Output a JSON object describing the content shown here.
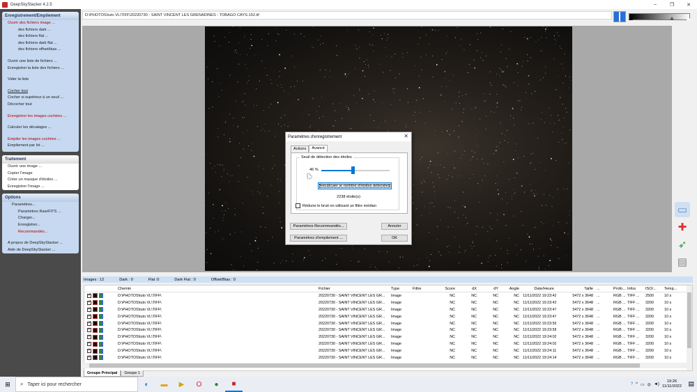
{
  "window": {
    "title": "DeepSkyStacker 4.2.5",
    "controls": [
      "–",
      "❐",
      "✕"
    ]
  },
  "sidebar": {
    "sections": [
      {
        "title": "Enregistrement/Empilement",
        "style": "blue",
        "items": [
          {
            "label": "Ouvrir des fichiers image ...",
            "color": "red",
            "indent": false,
            "underline": false
          },
          {
            "label": "des fichiers dark ...",
            "indent": true
          },
          {
            "label": "des fichiers flat ...",
            "indent": true
          },
          {
            "label": "des fichiers dark flat ...",
            "indent": true
          },
          {
            "label": "des fichiers offset/bias ...",
            "indent": true
          },
          {
            "gap": true
          },
          {
            "label": "Ouvrir une liste de fichiers ..."
          },
          {
            "label": "Enregistrer la liste des fichiers ..."
          },
          {
            "gap": true
          },
          {
            "label": "Vider la liste"
          },
          {
            "gap": true
          },
          {
            "label": "Cocher tout",
            "underline": true
          },
          {
            "label": "Cocher si supérieur à un seuil ..."
          },
          {
            "label": "Décocher tout"
          },
          {
            "gap": true
          },
          {
            "label": "Enregistrer les images cochées ...",
            "color": "red"
          },
          {
            "gap": true
          },
          {
            "label": "Calculer les décalages ..."
          },
          {
            "gap": true
          },
          {
            "label": "Empiler les images cochées ...",
            "color": "red"
          },
          {
            "label": "Empilement par lot ..."
          }
        ]
      },
      {
        "title": "Traitement",
        "style": "white",
        "items": [
          {
            "label": "Ouvrir une image ..."
          },
          {
            "label": "Copier l'image"
          },
          {
            "label": "Créer un masque d'étoiles ..."
          },
          {
            "label": "Enregistrer l'image ..."
          }
        ]
      },
      {
        "title": "Options",
        "style": "blue",
        "items": [
          {
            "label": "Paramètres...",
            "indent_level": 1
          },
          {
            "label": "Paramètres Raw/FITS ...",
            "indent": true
          },
          {
            "label": "Charger...",
            "indent": true
          },
          {
            "label": "Enregistrer...",
            "indent": true
          },
          {
            "label": "Recommandés...",
            "indent": true,
            "color": "red"
          },
          {
            "gap": true
          },
          {
            "label": "A propos de DeepSkyStacker ..."
          },
          {
            "label": "Aide de DeepSkyStacker ..."
          }
        ]
      }
    ]
  },
  "main": {
    "path": "D:\\PHOTOS\\tuto VL\\TIFF\\20220730 - SAINT VINCENT LES GRENADINES - TOBAGO CAYS-152.tif"
  },
  "dialog": {
    "title": "Paramètres d'enregistrement",
    "close": "✕",
    "tabs": [
      "Actions",
      "Avancé"
    ],
    "active_tab": 1,
    "group_label": "Seuil de détection des étoiles",
    "percent": "46 %",
    "slider_value": 0.46,
    "recalc_button": "Recalculer le nombre d'étoiles détectées",
    "star_count": "2238 étoile(s)",
    "checkbox_label": "Réduire le bruit en utilisant un filtre médian",
    "checkbox_checked": false,
    "btn_recommended": "Paramètres Recommandés...",
    "btn_stacking": "Paramètres d'empilement ...",
    "btn_cancel": "Annuler",
    "btn_ok": "OK"
  },
  "status": {
    "images": "Images : 12",
    "dark": "Dark : 0",
    "flat": "Flat :0",
    "darkflat": "Dark Flat : 0",
    "offset": "Offset/Bias : 0"
  },
  "table": {
    "columns": [
      "Chemin",
      "Fichier",
      "Type",
      "Filtre",
      "Score",
      "dX",
      "dY",
      "Angle",
      "Date/Heure",
      "Taille",
      "...",
      "Profo...",
      "Infos",
      "ISO/...",
      "Temp..."
    ],
    "rows": [
      {
        "path": "D:\\PHOTOS\\tuto VL\\TIFF\\",
        "file": "20220730 - SAINT VINCENT LES GR...",
        "type": "Image",
        "filter": "",
        "score": "NC",
        "dx": "NC",
        "dy": "NC",
        "angle": "NC",
        "date": "11/11/2022 19:23:42",
        "size": "5472 x 3648",
        "dots": "...",
        "profile": "RGB ...",
        "info": "TIFF ...",
        "iso": "2500",
        "temp": "10 s"
      },
      {
        "path": "D:\\PHOTOS\\tuto VL\\TIFF\\",
        "file": "20220730 - SAINT VINCENT LES GR...",
        "type": "Image",
        "filter": "",
        "score": "NC",
        "dx": "NC",
        "dy": "NC",
        "angle": "NC",
        "date": "11/11/2022 19:23:43",
        "size": "5472 x 3648",
        "dots": "...",
        "profile": "RGB ...",
        "info": "TIFF ...",
        "iso": "3200",
        "temp": "10 s"
      },
      {
        "path": "D:\\PHOTOS\\tuto VL\\TIFF\\",
        "file": "20220730 - SAINT VINCENT LES GR...",
        "type": "Image",
        "filter": "",
        "score": "NC",
        "dx": "NC",
        "dy": "NC",
        "angle": "NC",
        "date": "11/11/2022 19:23:47",
        "size": "5472 x 3648",
        "dots": "...",
        "profile": "RGB ...",
        "info": "TIFF ...",
        "iso": "3200",
        "temp": "10 s"
      },
      {
        "path": "D:\\PHOTOS\\tuto VL\\TIFF\\",
        "file": "20220730 - SAINT VINCENT LES GR...",
        "type": "Image",
        "filter": "",
        "score": "NC",
        "dx": "NC",
        "dy": "NC",
        "angle": "NC",
        "date": "11/11/2022 19:23:47",
        "size": "5472 x 3648",
        "dots": "...",
        "profile": "RGB ...",
        "info": "TIFF ...",
        "iso": "3200",
        "temp": "10 s"
      },
      {
        "path": "D:\\PHOTOS\\tuto VL\\TIFF\\",
        "file": "20220730 - SAINT VINCENT LES GR...",
        "type": "Image",
        "filter": "",
        "score": "NC",
        "dx": "NC",
        "dy": "NC",
        "angle": "NC",
        "date": "11/11/2022 19:23:56",
        "size": "5472 x 3648",
        "dots": "...",
        "profile": "RGB ...",
        "info": "TIFF ...",
        "iso": "3200",
        "temp": "10 s"
      },
      {
        "path": "D:\\PHOTOS\\tuto VL\\TIFF\\",
        "file": "20220730 - SAINT VINCENT LES GR...",
        "type": "Image",
        "filter": "",
        "score": "NC",
        "dx": "NC",
        "dy": "NC",
        "angle": "NC",
        "date": "11/11/2022 19:23:58",
        "size": "5472 x 3648",
        "dots": "...",
        "profile": "RGB ...",
        "info": "TIFF ...",
        "iso": "3200",
        "temp": "10 s"
      },
      {
        "path": "D:\\PHOTOS\\tuto VL\\TIFF\\",
        "file": "20220730 - SAINT VINCENT LES GR...",
        "type": "Image",
        "filter": "",
        "score": "NC",
        "dx": "NC",
        "dy": "NC",
        "angle": "NC",
        "date": "11/11/2022 19:24:02",
        "size": "5472 x 3648",
        "dots": "...",
        "profile": "RGB ...",
        "info": "TIFF ...",
        "iso": "3200",
        "temp": "10 s"
      },
      {
        "path": "D:\\PHOTOS\\tuto VL\\TIFF\\",
        "file": "20220730 - SAINT VINCENT LES GR...",
        "type": "Image",
        "filter": "",
        "score": "NC",
        "dx": "NC",
        "dy": "NC",
        "angle": "NC",
        "date": "11/11/2022 19:24:02",
        "size": "5472 x 3648",
        "dots": "...",
        "profile": "RGB ...",
        "info": "TIFF ...",
        "iso": "3200",
        "temp": "10 s"
      },
      {
        "path": "D:\\PHOTOS\\tuto VL\\TIFF\\",
        "file": "20220730 - SAINT VINCENT LES GR...",
        "type": "Image",
        "filter": "",
        "score": "NC",
        "dx": "NC",
        "dy": "NC",
        "angle": "NC",
        "date": "11/11/2022 19:24:11",
        "size": "5472 x 3648",
        "dots": "...",
        "profile": "RGB ...",
        "info": "TIFF ...",
        "iso": "3200",
        "temp": "10 s"
      },
      {
        "path": "D:\\PHOTOS\\tuto VL\\TIFF\\",
        "file": "20220730 - SAINT VINCENT LES GR...",
        "type": "Image",
        "filter": "",
        "score": "NC",
        "dx": "NC",
        "dy": "NC",
        "angle": "NC",
        "date": "11/11/2022 19:24:14",
        "size": "5472 x 3648",
        "dots": "...",
        "profile": "RGB ...",
        "info": "TIFF ...",
        "iso": "3200",
        "temp": "10 s"
      }
    ]
  },
  "groups": [
    "Groupe Principal",
    "Groupe 1"
  ],
  "taskbar": {
    "search_placeholder": "Taper ici pour rechercher",
    "time": "19:26",
    "date": "11/11/2022"
  },
  "colors": {
    "accent": "#0078d7",
    "red_text": "#b00000",
    "sidebar_bg": "#4a4a4a"
  }
}
